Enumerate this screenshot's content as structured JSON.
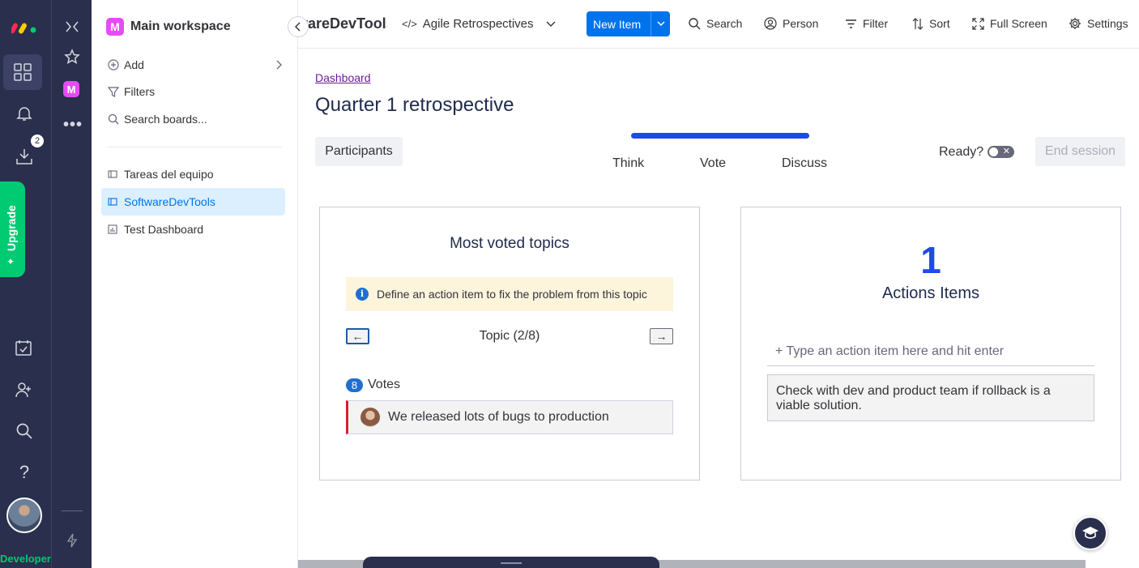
{
  "rail": {
    "notifications_badge": "2",
    "upgrade_label": "Upgrade",
    "developer_label": "Developer",
    "workspace_letter": "M"
  },
  "workspace": {
    "title": "Main workspace",
    "add_label": "Add",
    "filters_label": "Filters",
    "search_label": "Search boards...",
    "boards": [
      {
        "label": "Tareas del equipo",
        "icon": "board-icon"
      },
      {
        "label": "SoftwareDevTools",
        "icon": "board-icon",
        "active": true
      },
      {
        "label": "Test Dashboard",
        "icon": "dashboard-icon"
      }
    ]
  },
  "toolbar": {
    "board_name": "SoftwareDevTools",
    "view_name": "Agile Retrospectives",
    "new_item_label": "New Item",
    "search_label": "Search",
    "person_label": "Person",
    "filter_label": "Filter",
    "sort_label": "Sort",
    "fullscreen_label": "Full Screen",
    "settings_label": "Settings"
  },
  "page": {
    "breadcrumb": "Dashboard",
    "title": "Quarter 1 retrospective",
    "participants_label": "Participants",
    "steps": [
      "Think",
      "Vote",
      "Discuss"
    ],
    "ready_label": "Ready?",
    "end_session_label": "End session"
  },
  "topics": {
    "title": "Most voted topics",
    "info_text": "Define an action item to fix the problem from this topic",
    "prev_arrow": "←",
    "next_arrow": "→",
    "topic_label": "Topic (2/8)",
    "vote_count": "8",
    "votes_label": "Votes",
    "item_text": "We released lots of bugs to production"
  },
  "actions": {
    "count": "1",
    "title": "Actions Items",
    "input_placeholder": "+ Type an action item here and hit enter",
    "items": [
      "Check with dev and product team if rollback is a viable solution."
    ]
  },
  "colors": {
    "rail": "#292f4c",
    "primary": "#0073ea",
    "progress": "#1f4aea",
    "upgrade": "#00ca72",
    "topic_border": "#d91e2e"
  }
}
